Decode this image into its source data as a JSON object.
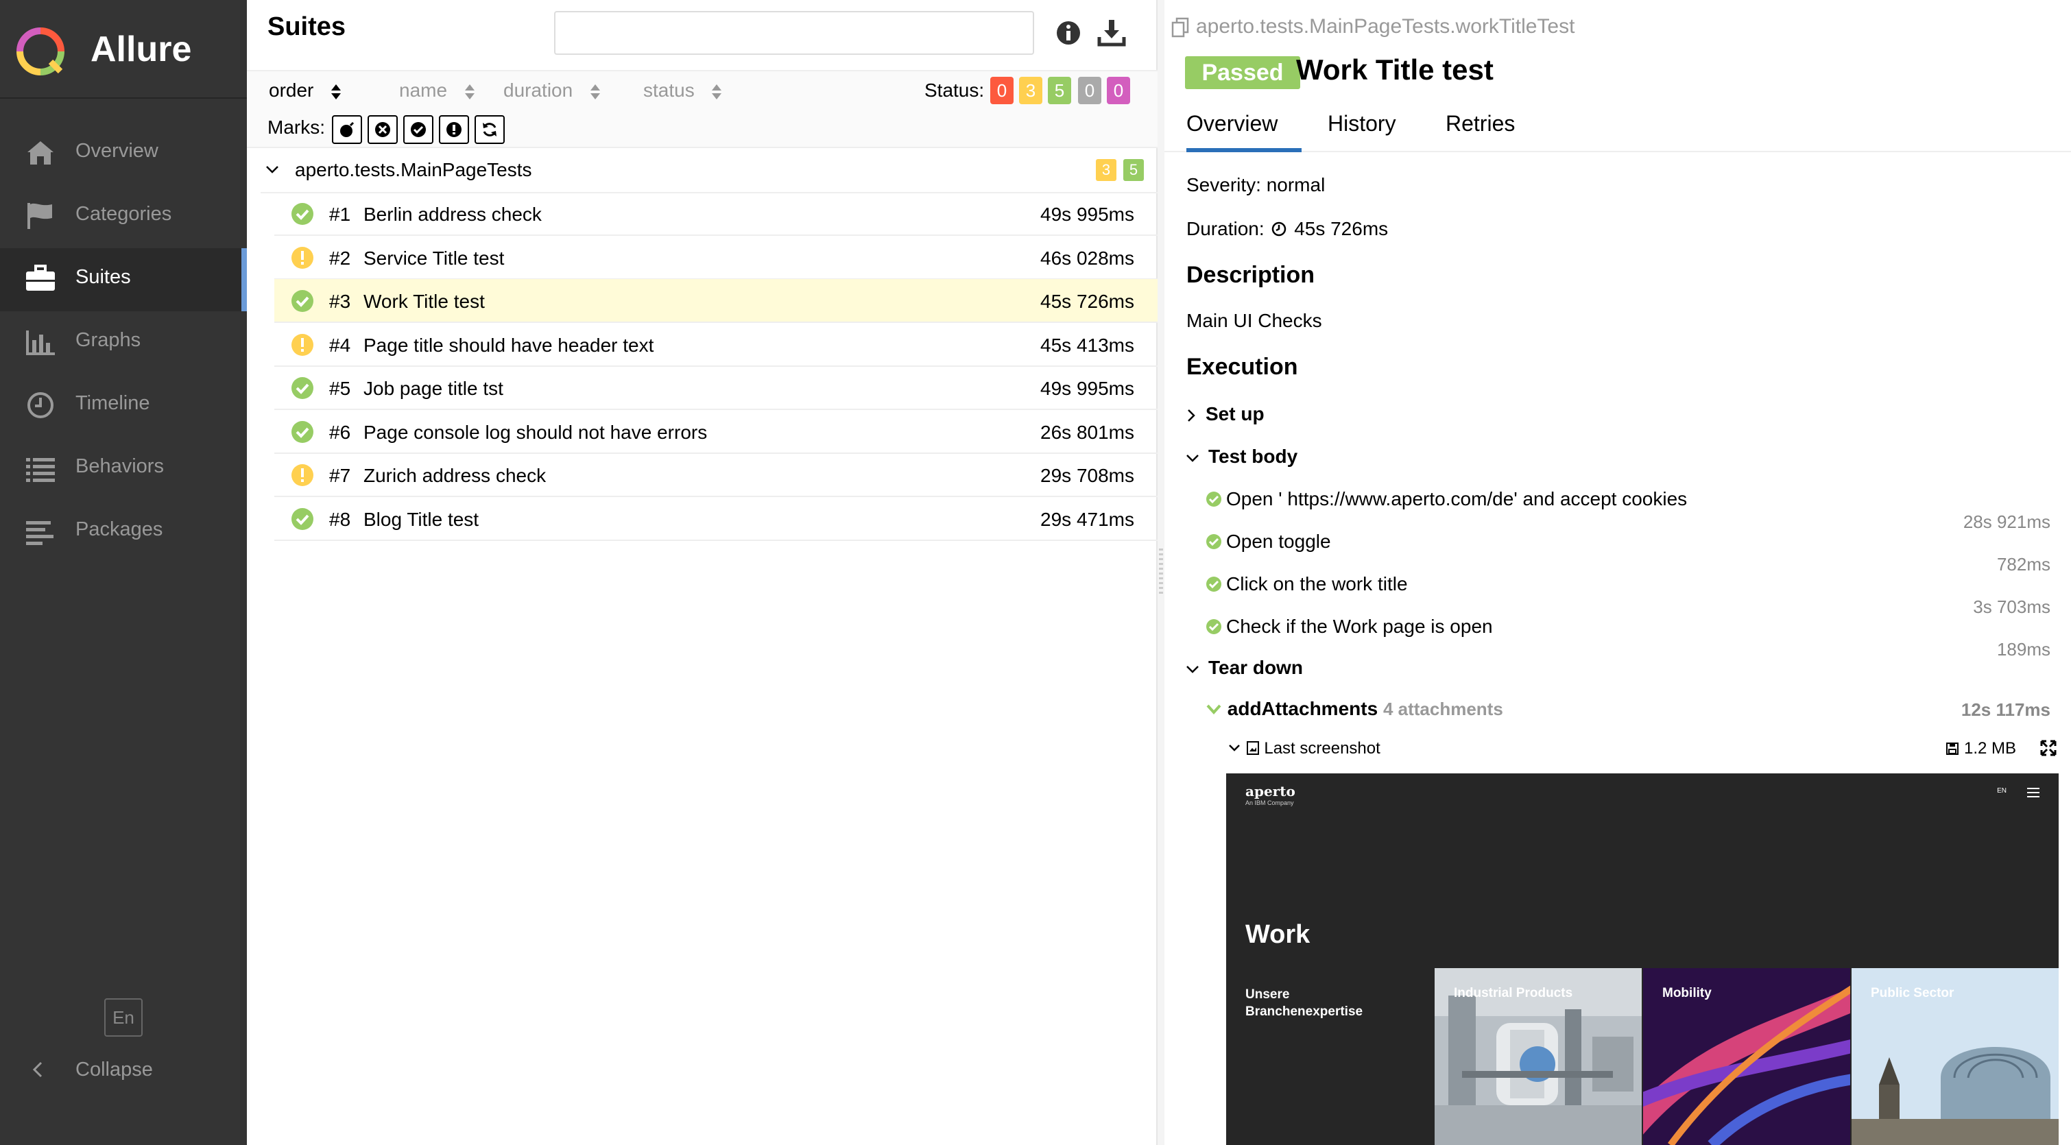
{
  "brand": {
    "name": "Allure"
  },
  "nav": [
    {
      "label": "Overview",
      "icon": "home-icon"
    },
    {
      "label": "Categories",
      "icon": "flag-icon"
    },
    {
      "label": "Suites",
      "icon": "briefcase-icon",
      "active": true
    },
    {
      "label": "Graphs",
      "icon": "bar-chart-icon"
    },
    {
      "label": "Timeline",
      "icon": "clock-icon"
    },
    {
      "label": "Behaviors",
      "icon": "list-icon"
    },
    {
      "label": "Packages",
      "icon": "align-left-icon"
    }
  ],
  "footer": {
    "lang": "En",
    "collapse": "Collapse"
  },
  "suites": {
    "title": "Suites",
    "search": {
      "value": "",
      "placeholder": ""
    },
    "sort": [
      "order",
      "name",
      "duration",
      "status"
    ],
    "status_label": "Status:",
    "status_counts": [
      {
        "value": "0",
        "color": "#fd5a3e"
      },
      {
        "value": "3",
        "color": "#ffd050"
      },
      {
        "value": "5",
        "color": "#97cc64"
      },
      {
        "value": "0",
        "color": "#aaaaaa"
      },
      {
        "value": "0",
        "color": "#d35ebe"
      }
    ],
    "marks_label": "Marks:",
    "group": {
      "name": "aperto.tests.MainPageTests",
      "broken": "3",
      "passed": "5"
    },
    "tests": [
      {
        "num": "#1",
        "name": "Berlin address check",
        "duration": "49s 995ms",
        "status": "passed"
      },
      {
        "num": "#2",
        "name": "Service Title test",
        "duration": "46s 028ms",
        "status": "broken"
      },
      {
        "num": "#3",
        "name": "Work Title test",
        "duration": "45s 726ms",
        "status": "passed",
        "selected": true
      },
      {
        "num": "#4",
        "name": "Page title should have header text",
        "duration": "45s 413ms",
        "status": "broken"
      },
      {
        "num": "#5",
        "name": "Job page title tst",
        "duration": "49s 995ms",
        "status": "passed"
      },
      {
        "num": "#6",
        "name": "Page console log should not have errors",
        "duration": "26s 801ms",
        "status": "passed"
      },
      {
        "num": "#7",
        "name": "Zurich address check",
        "duration": "29s 708ms",
        "status": "broken"
      },
      {
        "num": "#8",
        "name": "Blog Title test",
        "duration": "29s 471ms",
        "status": "passed"
      }
    ]
  },
  "result": {
    "full_name": "aperto.tests.MainPageTests.workTitleTest",
    "status": "Passed",
    "title": "Work Title test",
    "tabs": [
      "Overview",
      "History",
      "Retries"
    ],
    "severity": "Severity: normal",
    "duration_label": "Duration:",
    "duration": "45s 726ms",
    "description_head": "Description",
    "description": "Main UI Checks",
    "execution_head": "Execution",
    "setup": "Set up",
    "test_body": "Test body",
    "steps": [
      {
        "name": "Open ' https://www.aperto.com/de' and accept cookies",
        "duration": "28s 921ms"
      },
      {
        "name": "Open toggle",
        "duration": "782ms"
      },
      {
        "name": "Click on the work title",
        "duration": "3s 703ms"
      },
      {
        "name": "Check if the Work page is open",
        "duration": "189ms"
      }
    ],
    "teardown": "Tear down",
    "attach_step": "addAttachments",
    "attach_count": "4 attachments",
    "attach_duration": "12s 117ms",
    "screenshot_label": "Last screenshot",
    "screenshot_size": "1.2 MB"
  },
  "screenshot": {
    "logo": "aperto",
    "logo_sub": "An IBM Company",
    "lang": "EN",
    "heading": "Work",
    "lead": "Unsere Branchenexpertise",
    "cards": [
      "Industrial Products",
      "Mobility",
      "Public Sector"
    ]
  }
}
